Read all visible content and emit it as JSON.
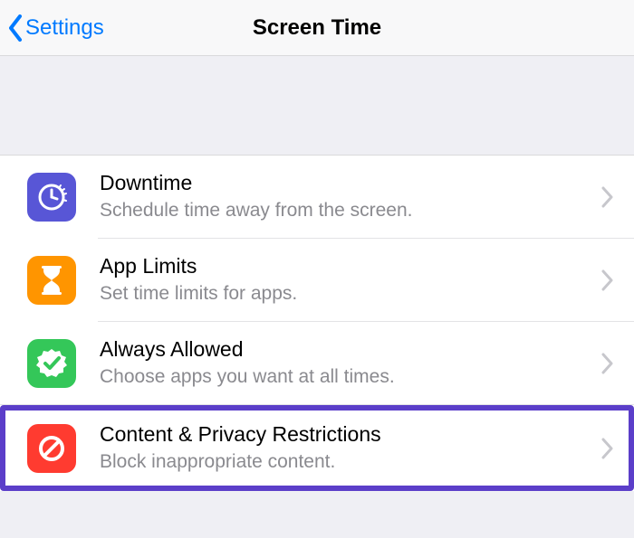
{
  "nav": {
    "back_label": "Settings",
    "title": "Screen Time"
  },
  "rows": {
    "downtime": {
      "title": "Downtime",
      "sub": "Schedule time away from the screen."
    },
    "applimits": {
      "title": "App Limits",
      "sub": "Set time limits for apps."
    },
    "allowed": {
      "title": "Always Allowed",
      "sub": "Choose apps you want at all times."
    },
    "content": {
      "title": "Content & Privacy Restrictions",
      "sub": "Block inappropriate content."
    }
  },
  "colors": {
    "highlight_border": "#5b3ec9",
    "ios_blue": "#007aff"
  }
}
